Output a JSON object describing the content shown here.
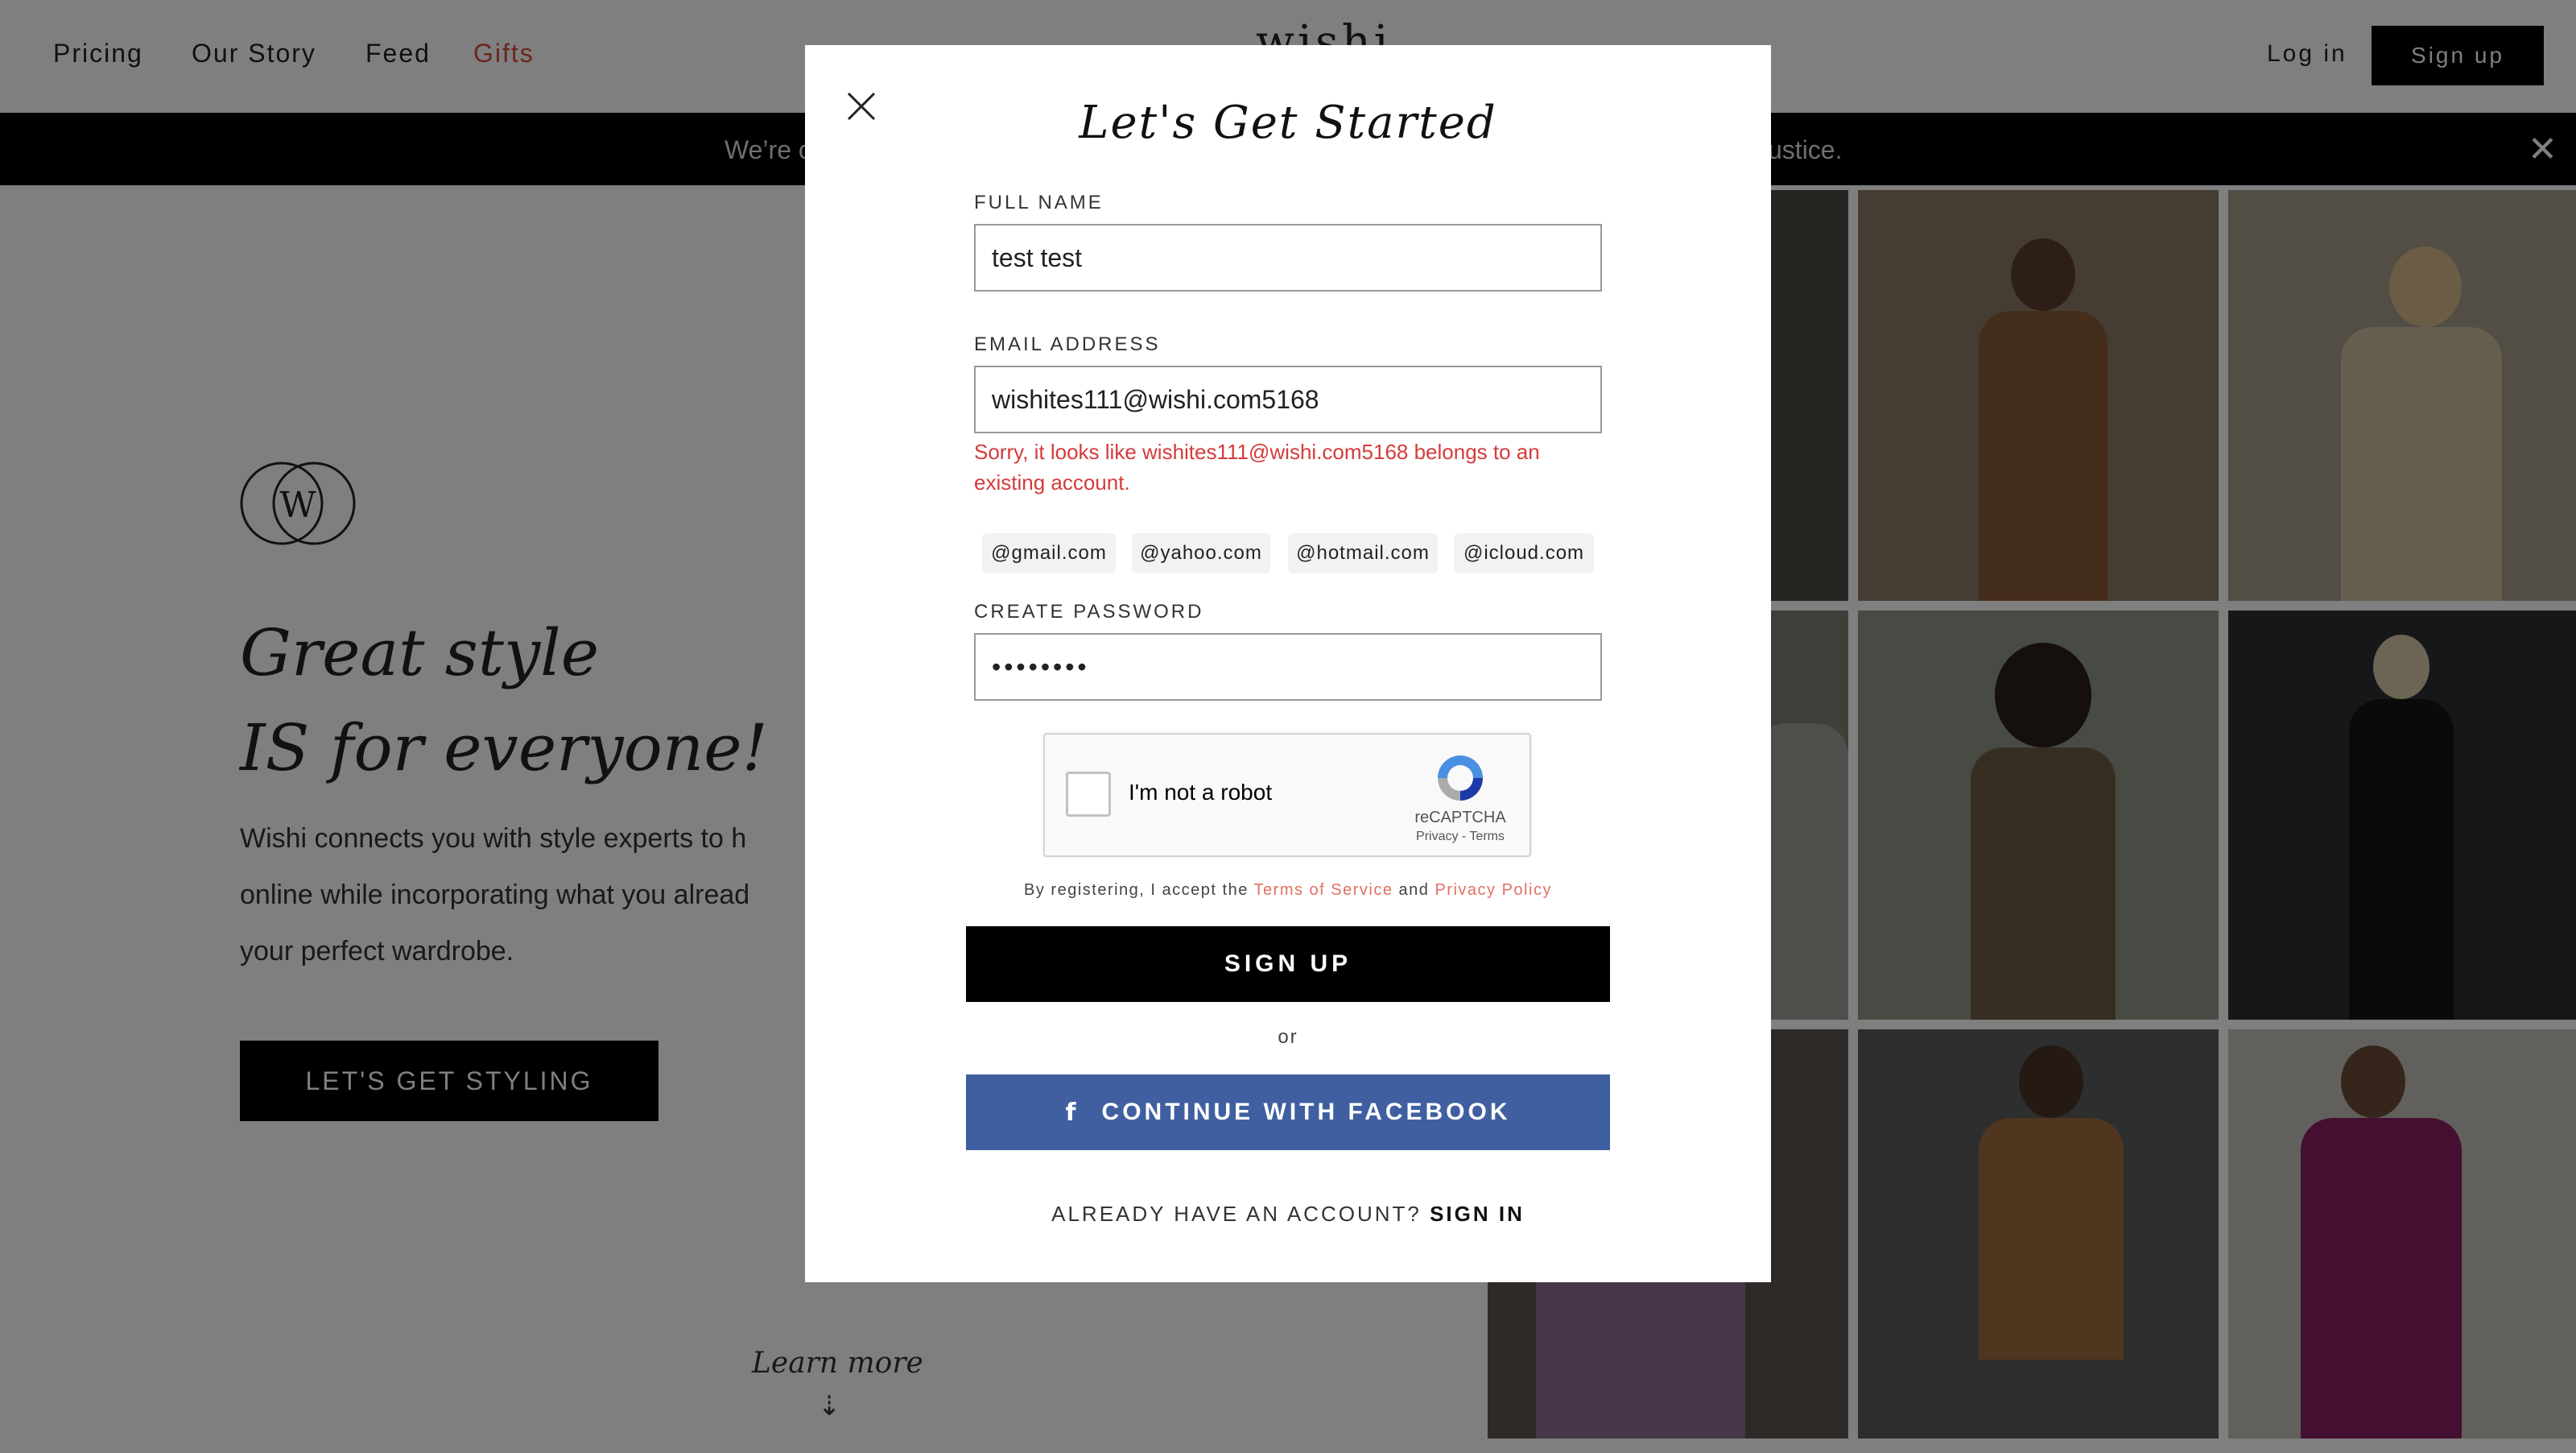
{
  "nav": {
    "links": [
      "Pricing",
      "Our Story",
      "Feed",
      "Gifts"
    ],
    "logo": "wishi",
    "login": "Log in",
    "signup": "Sign up"
  },
  "banner": {
    "text_left": "We’re c",
    "text_right": "ustice.",
    "close_icon": "close-icon"
  },
  "hero": {
    "title_line1": "Great style",
    "title_line2": "IS for everyone!",
    "desc_line1": "Wishi connects you with style experts to h",
    "desc_line2": "online while incorporating what you alread",
    "desc_line3": "your perfect wardrobe.",
    "cta": "LET'S GET STYLING",
    "learn_more": "Learn more",
    "learn_more_arrow": "⇣",
    "logo_letter": "W"
  },
  "modal": {
    "title": "Let's Get Started",
    "full_name_label": "FULL NAME",
    "full_name_value": "test test",
    "email_label": "EMAIL ADDRESS",
    "email_value": "wishites111@wishi.com5168",
    "email_error_line1": "Sorry, it looks like wishites111@wishi.com5168 belongs to an",
    "email_error_line2": "existing account.",
    "domain_chips": [
      "@gmail.com",
      "@yahoo.com",
      "@hotmail.com",
      "@icloud.com"
    ],
    "password_label": "CREATE PASSWORD",
    "password_value": "••••••••",
    "recaptcha": {
      "label": "I'm not a robot",
      "brand": "reCAPTCHA",
      "links": "Privacy - Terms"
    },
    "terms_prefix": "By registering, I accept the",
    "terms_link": "Terms of Service",
    "terms_and": "and",
    "privacy_link": "Privacy Policy",
    "signup_button": "SIGN UP",
    "or": "or",
    "facebook_icon": "f",
    "facebook_button": "CONTINUE WITH FACEBOOK",
    "already_text": "ALREADY HAVE AN ACCOUNT?",
    "signin_link": "SIGN IN"
  },
  "colors": {
    "accent_red": "#d84a3a",
    "error_red": "#d43b3b",
    "facebook_blue": "#3f5fa0",
    "overlay": "rgba(0,0,0,0.5)"
  }
}
